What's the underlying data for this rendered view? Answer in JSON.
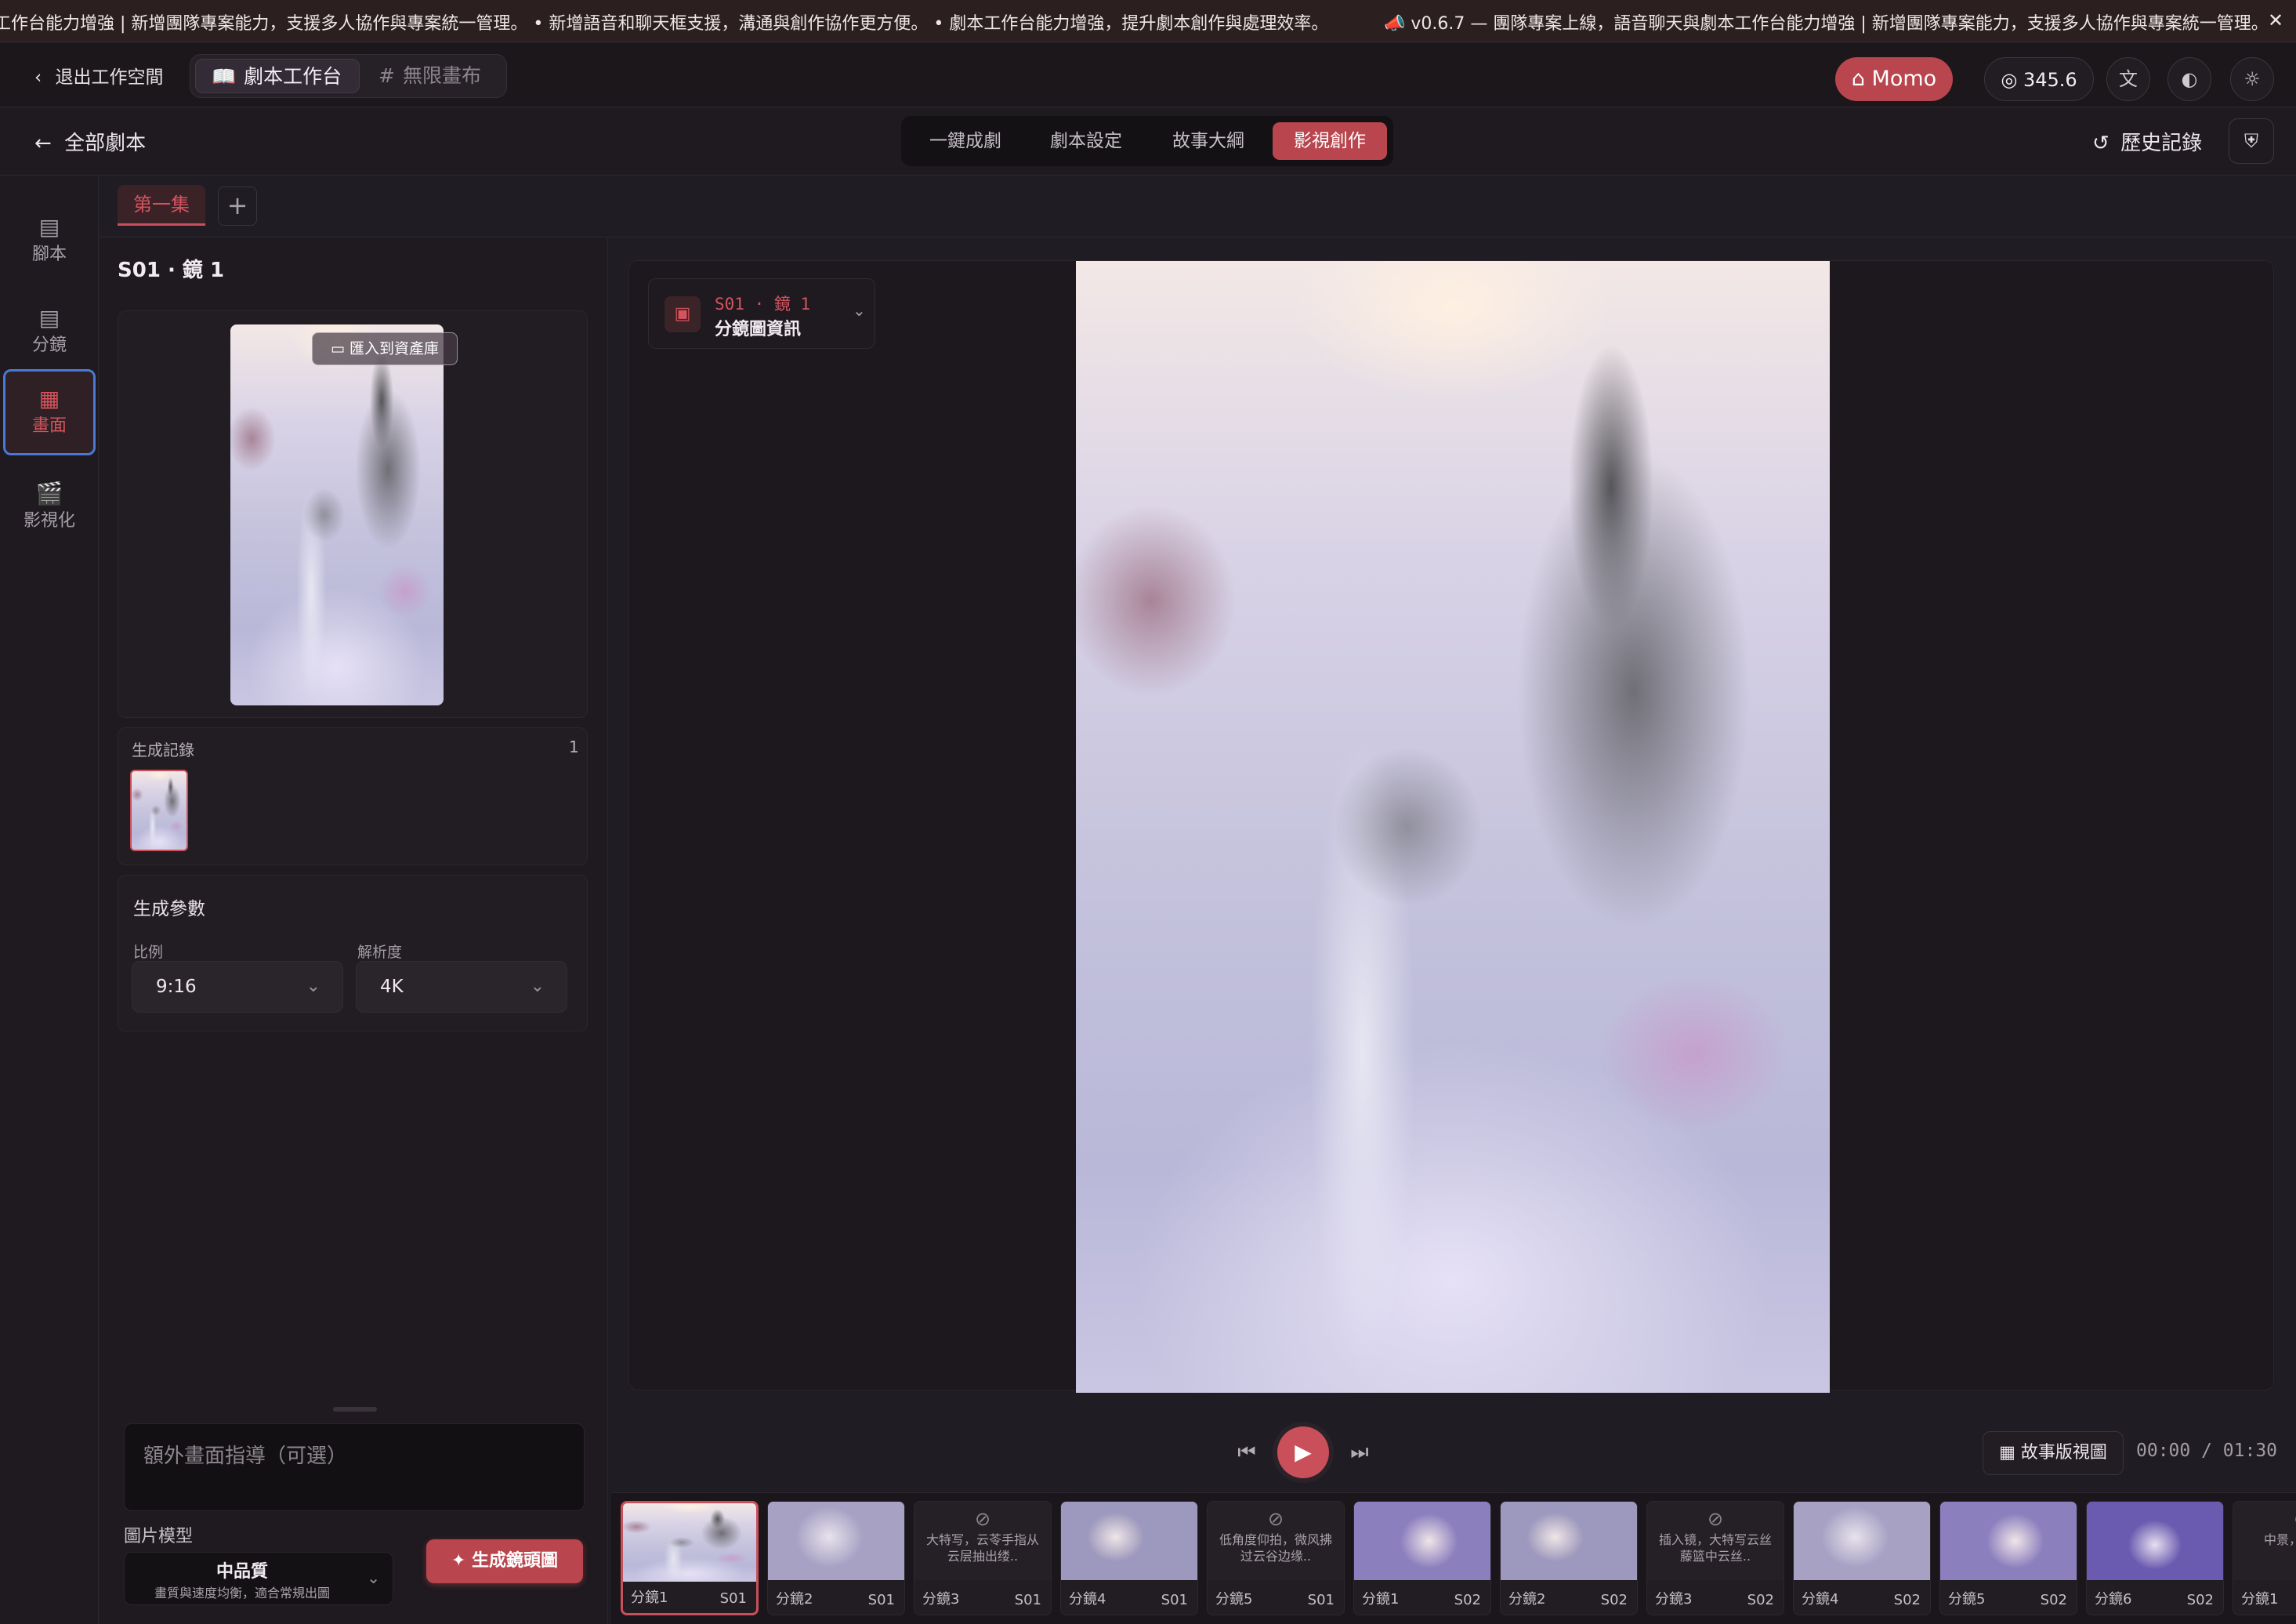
{
  "marquee": {
    "text1": "工作台能力增強 | 新增團隊專案能力，支援多人協作與專案統一管理。 • 新增語音和聊天框支援，溝通與創作協作更方便。 • 劇本工作台能力增強，提升劇本創作與處理效率。",
    "text2": "📣 v0.6.7 — 團隊專案上線，語音聊天與劇本工作台能力增強 | 新增團隊專案能力，支援多人協作與專案統一管理。 •",
    "close": "✕"
  },
  "topbar": {
    "exit_workspace": "退出工作空間",
    "tab_script_workbench": "劇本工作台",
    "tab_infinite_canvas": "無限畫布",
    "momo": "Momo",
    "credits": "345.6"
  },
  "secbar": {
    "all_scripts": "全部劇本",
    "modes": [
      "一鍵成劇",
      "劇本設定",
      "故事大綱",
      "影視創作"
    ],
    "active_mode": "影視創作",
    "history": "歷史記錄"
  },
  "rail": {
    "items": [
      {
        "label": "腳本",
        "icon": "script-icon"
      },
      {
        "label": "分鏡",
        "icon": "storyboard-icon"
      },
      {
        "label": "畫面",
        "icon": "frame-icon",
        "active": true
      },
      {
        "label": "影視化",
        "icon": "clapper-icon"
      }
    ]
  },
  "episode": {
    "tab": "第一集",
    "add": "+"
  },
  "left": {
    "shot_title": "S01 · 鏡 1",
    "import_button": "匯入到資產庫",
    "gen_record_label": "生成記錄",
    "gen_record_count": "1",
    "params_title": "生成參數",
    "ratio_label": "比例",
    "ratio_value": "9:16",
    "res_label": "解析度",
    "res_value": "4K",
    "prompt_placeholder": "額外畫面指導（可選）",
    "model_label": "圖片模型",
    "model_name": "中品質",
    "model_desc": "畫質與速度均衡，適合常規出圖",
    "generate_button": "生成鏡頭圖"
  },
  "stage": {
    "info_code": "S01 · 鏡 1",
    "info_title": "分鏡圖資訊"
  },
  "player": {
    "storyboard_view": "故事版視圖",
    "timecode": "00:00 / 01:30"
  },
  "strip": {
    "frames": [
      {
        "name": "分鏡1",
        "scene": "S01",
        "type": "image",
        "style": "cloudscape",
        "active": true
      },
      {
        "name": "分鏡2",
        "scene": "S01",
        "type": "image",
        "style": "portrait-a"
      },
      {
        "name": "分鏡3",
        "scene": "S01",
        "type": "empty",
        "text": "大特写，云苓手指从云层抽出缕.."
      },
      {
        "name": "分鏡4",
        "scene": "S01",
        "type": "image",
        "style": "portrait-b"
      },
      {
        "name": "分鏡5",
        "scene": "S01",
        "type": "empty",
        "text": "低角度仰拍，微风拂过云谷边缘.."
      },
      {
        "name": "分鏡1",
        "scene": "S02",
        "type": "image",
        "style": "portrait-c"
      },
      {
        "name": "分鏡2",
        "scene": "S02",
        "type": "image",
        "style": "portrait-b"
      },
      {
        "name": "分鏡3",
        "scene": "S02",
        "type": "empty",
        "text": "插入镜，大特写云丝藤篮中云丝.."
      },
      {
        "name": "分鏡4",
        "scene": "S02",
        "type": "image",
        "style": "portrait-a"
      },
      {
        "name": "分鏡5",
        "scene": "S02",
        "type": "image",
        "style": "portrait-c"
      },
      {
        "name": "分鏡6",
        "scene": "S02",
        "type": "image",
        "style": "portrait-d"
      },
      {
        "name": "分鏡1",
        "scene": "",
        "type": "empty",
        "text": "中景，来将旋"
      }
    ]
  }
}
